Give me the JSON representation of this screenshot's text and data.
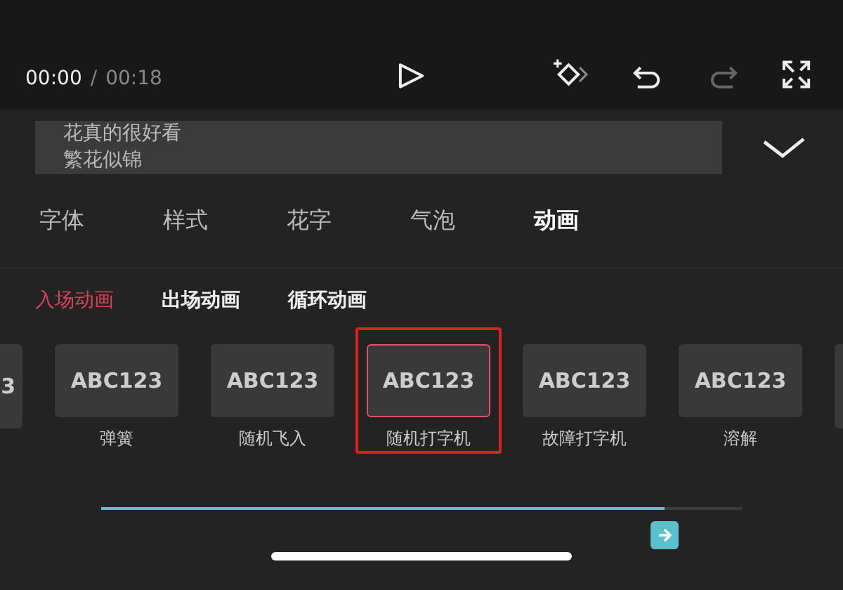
{
  "player": {
    "current_time": "00:00",
    "separator": "/",
    "total_time": "00:18"
  },
  "text_input": {
    "lines": [
      "花真的很好看",
      "繁花似锦"
    ]
  },
  "tabs": [
    {
      "label": "字体",
      "selected": false
    },
    {
      "label": "样式",
      "selected": false
    },
    {
      "label": "花字",
      "selected": false
    },
    {
      "label": "气泡",
      "selected": false
    },
    {
      "label": "动画",
      "selected": true
    }
  ],
  "sub_tabs": [
    {
      "label": "入场动画",
      "selected": true
    },
    {
      "label": "出场动画",
      "selected": false
    },
    {
      "label": "循环动画",
      "selected": false
    }
  ],
  "animations": [
    {
      "preview": "3",
      "selected": false
    },
    {
      "preview": "ABC123",
      "label": "弹簧",
      "selected": false
    },
    {
      "preview": "ABC123",
      "label": "随机飞入",
      "selected": false
    },
    {
      "preview": "ABC123",
      "label": "随机打字机",
      "selected": true
    },
    {
      "preview": "ABC123",
      "label": "故障打字机",
      "selected": false
    },
    {
      "preview": "ABC123",
      "label": "溶解",
      "selected": false
    },
    {
      "selected": false
    }
  ],
  "duration_slider": {
    "level": 0.88
  }
}
